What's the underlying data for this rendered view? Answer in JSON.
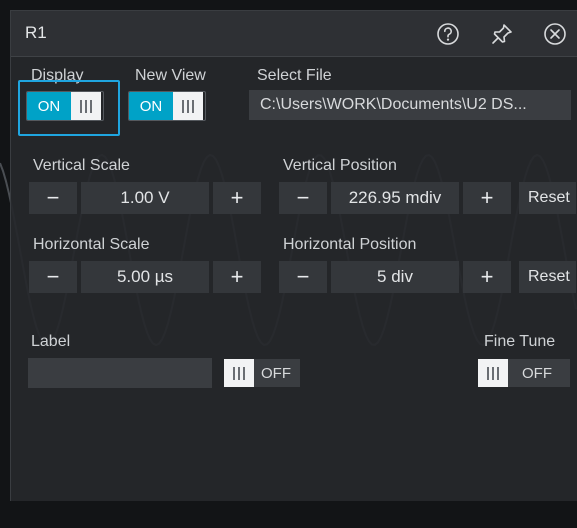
{
  "dialog": {
    "title": "R1",
    "icons": [
      "help-icon",
      "pin-icon",
      "close-icon"
    ]
  },
  "display": {
    "label": "Display",
    "state": "ON"
  },
  "new_view": {
    "label": "New View",
    "state": "ON"
  },
  "select_file": {
    "label": "Select File",
    "value": "C:\\Users\\WORK\\Documents\\U2 DS..."
  },
  "vertical_scale": {
    "label": "Vertical Scale",
    "value": "1.00 V",
    "minus": "−",
    "plus": "+"
  },
  "vertical_position": {
    "label": "Vertical Position",
    "value": "226.95 mdiv",
    "minus": "−",
    "plus": "+",
    "reset": "Reset"
  },
  "horizontal_scale": {
    "label": "Horizontal Scale",
    "value": "5.00 µs",
    "minus": "−",
    "plus": "+"
  },
  "horizontal_position": {
    "label": "Horizontal Position",
    "value": "5 div",
    "minus": "−",
    "plus": "+",
    "reset": "Reset"
  },
  "label_field": {
    "label": "Label",
    "value": "",
    "toggle_state": "OFF"
  },
  "fine_tune": {
    "label": "Fine Tune",
    "state": "OFF"
  },
  "colors": {
    "accent": "#00a2c7",
    "focus": "#1fa5e0",
    "panel": "#26282b",
    "field": "#34373b"
  }
}
